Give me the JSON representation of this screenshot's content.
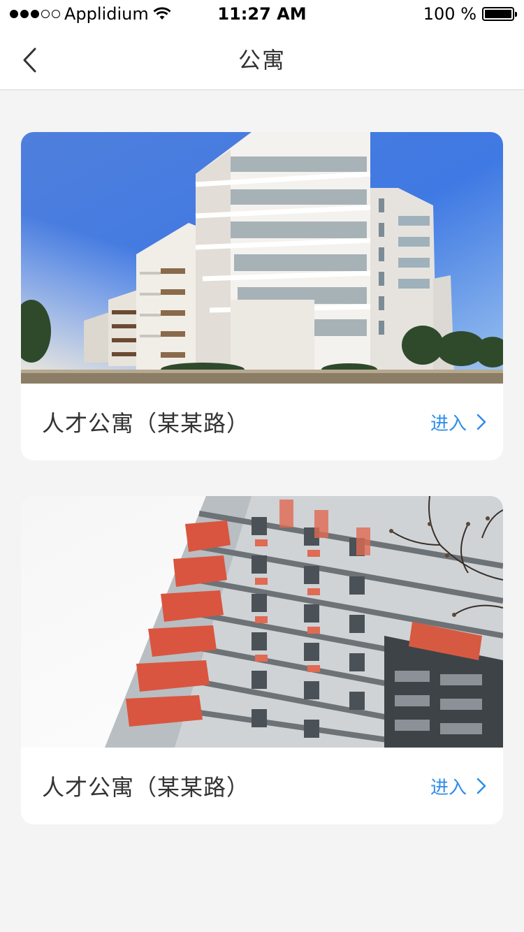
{
  "status_bar": {
    "carrier": "Applidium",
    "time": "11:27 AM",
    "battery": "100 %",
    "signal_strength": 3,
    "signal_total": 5
  },
  "nav": {
    "title": "公寓",
    "back_icon": "chevron-left-icon"
  },
  "colors": {
    "accent": "#2f8ee8",
    "page_background": "#f4f4f4",
    "card_background": "#ffffff"
  },
  "apartments": [
    {
      "title": "人才公寓（某某路）",
      "action_label": "进入",
      "image": "modern-white-apartment-building-photo"
    },
    {
      "title": "人才公寓（某某路）",
      "action_label": "进入",
      "image": "gray-red-highrise-apartment-photo"
    }
  ]
}
